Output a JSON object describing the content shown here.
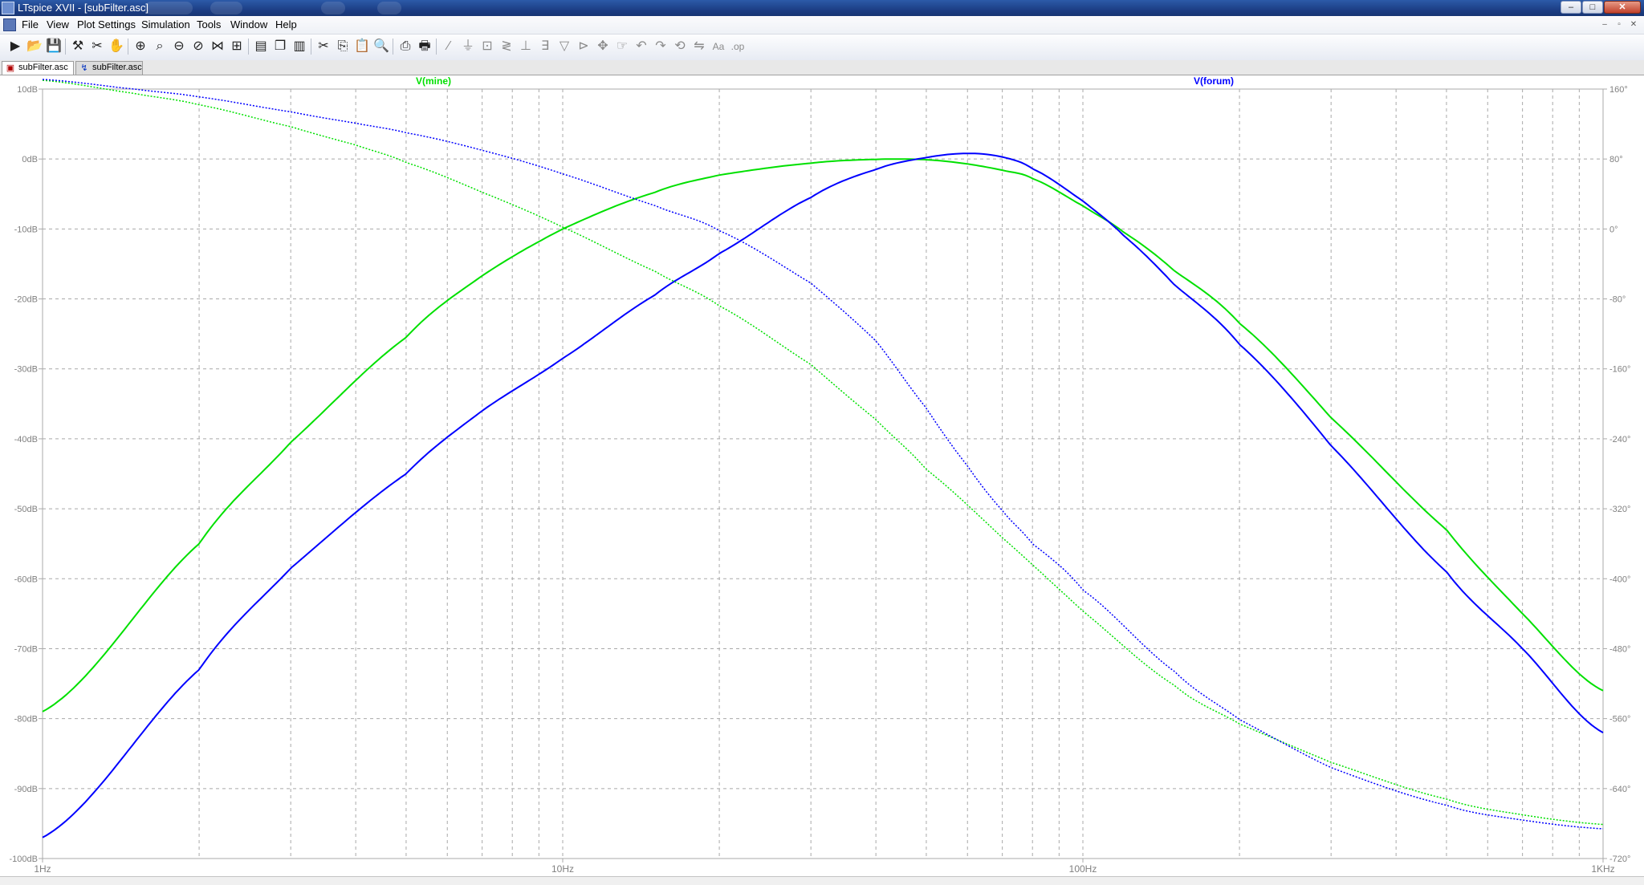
{
  "window": {
    "title": "LTspice XVII - [subFilter.asc]",
    "controls": {
      "minimize": "–",
      "maximize": "□",
      "close": "✕"
    },
    "mdi_controls": {
      "minimize": "–",
      "restore": "▫",
      "close": "✕"
    }
  },
  "menu": {
    "items": [
      {
        "label": "File"
      },
      {
        "label": "View"
      },
      {
        "label": "Plot Settings"
      },
      {
        "label": "Simulation"
      },
      {
        "label": "Tools"
      },
      {
        "label": "Window"
      },
      {
        "label": "Help"
      }
    ]
  },
  "toolbar": {
    "buttons": [
      {
        "name": "run-icon",
        "glyph": "▶"
      },
      {
        "name": "open-icon",
        "glyph": "📂"
      },
      {
        "name": "save-icon",
        "glyph": "💾"
      },
      {
        "name": "probe-icon",
        "glyph": "⚒"
      },
      {
        "name": "halt-icon",
        "glyph": "✂"
      },
      {
        "name": "hand-icon",
        "glyph": "✋"
      },
      {
        "name": "zoom-in-icon",
        "glyph": "⊕"
      },
      {
        "name": "zoom-area-icon",
        "glyph": "⌕"
      },
      {
        "name": "zoom-out-icon",
        "glyph": "⊖"
      },
      {
        "name": "zoom-cancel-icon",
        "glyph": "⊘"
      },
      {
        "name": "autorange-icon",
        "glyph": "⋈"
      },
      {
        "name": "fit-icon",
        "glyph": "⊞"
      },
      {
        "name": "tile-horizontal-icon",
        "glyph": "▤"
      },
      {
        "name": "cascade-icon",
        "glyph": "❐"
      },
      {
        "name": "tile-vertical-icon",
        "glyph": "▥"
      },
      {
        "name": "cut-icon",
        "glyph": "✂"
      },
      {
        "name": "copy-icon",
        "glyph": "⎘"
      },
      {
        "name": "paste-icon",
        "glyph": "📋"
      },
      {
        "name": "find-icon",
        "glyph": "🔍"
      },
      {
        "name": "print-preview-icon",
        "glyph": "⎙"
      },
      {
        "name": "print-icon",
        "glyph": "🖶"
      },
      {
        "name": "wire-icon",
        "glyph": "∕"
      },
      {
        "name": "ground-icon",
        "glyph": "⏚"
      },
      {
        "name": "label-icon",
        "glyph": "⊡"
      },
      {
        "name": "resistor-icon",
        "glyph": "≷"
      },
      {
        "name": "capacitor-icon",
        "glyph": "⊥"
      },
      {
        "name": "inductor-icon",
        "glyph": "∃"
      },
      {
        "name": "diode-icon",
        "glyph": "▽"
      },
      {
        "name": "component-icon",
        "glyph": "⊳"
      },
      {
        "name": "move-icon",
        "glyph": "✥"
      },
      {
        "name": "drag-icon",
        "glyph": "☞"
      },
      {
        "name": "undo-icon",
        "glyph": "↶"
      },
      {
        "name": "redo-icon",
        "glyph": "↷"
      },
      {
        "name": "rotate-icon",
        "glyph": "⟲"
      },
      {
        "name": "mirror-icon",
        "glyph": "⇋"
      },
      {
        "name": "text-icon",
        "glyph": "Aa"
      },
      {
        "name": "spice-directive-icon",
        "glyph": ".op"
      }
    ]
  },
  "tabs": [
    {
      "label": "subFilter.asc",
      "active": true,
      "icon": "schematic-icon",
      "glyph": "▣"
    },
    {
      "label": "subFilter.asc",
      "active": false,
      "icon": "waveform-icon",
      "glyph": "↯"
    }
  ],
  "plot": {
    "background": "#ffffff",
    "grid_color": "#a9a9a9",
    "axis_text_color": "#808080",
    "traces": [
      {
        "name": "V(mine)",
        "color": "#00e000"
      },
      {
        "name": "V(forum)",
        "color": "#0000ff"
      }
    ],
    "x_axis": {
      "scale": "log",
      "range_hz": [
        1,
        1000
      ],
      "ticks": [
        {
          "value": 1,
          "label": "1Hz"
        },
        {
          "value": 10,
          "label": "10Hz"
        },
        {
          "value": 100,
          "label": "100Hz"
        },
        {
          "value": 1000,
          "label": "1KHz"
        }
      ]
    },
    "y_left": {
      "unit": "dB",
      "range": [
        -100,
        10
      ],
      "ticks": [
        {
          "value": 10,
          "label": "10dB"
        },
        {
          "value": 0,
          "label": "0dB"
        },
        {
          "value": -10,
          "label": "-10dB"
        },
        {
          "value": -20,
          "label": "-20dB"
        },
        {
          "value": -30,
          "label": "-30dB"
        },
        {
          "value": -40,
          "label": "-40dB"
        },
        {
          "value": -50,
          "label": "-50dB"
        },
        {
          "value": -60,
          "label": "-60dB"
        },
        {
          "value": -70,
          "label": "-70dB"
        },
        {
          "value": -80,
          "label": "-80dB"
        },
        {
          "value": -90,
          "label": "-90dB"
        },
        {
          "value": -100,
          "label": "-100dB"
        }
      ]
    },
    "y_right": {
      "unit": "°",
      "range": [
        -720,
        160
      ],
      "ticks": [
        {
          "value": 160,
          "label": "160°"
        },
        {
          "value": 80,
          "label": "80°"
        },
        {
          "value": 0,
          "label": "0°"
        },
        {
          "value": -80,
          "label": "-80°"
        },
        {
          "value": -160,
          "label": "-160°"
        },
        {
          "value": -240,
          "label": "-240°"
        },
        {
          "value": -320,
          "label": "-320°"
        },
        {
          "value": -400,
          "label": "-400°"
        },
        {
          "value": -480,
          "label": "-480°"
        },
        {
          "value": -560,
          "label": "-560°"
        },
        {
          "value": -640,
          "label": "-640°"
        },
        {
          "value": -720,
          "label": "-720°"
        }
      ]
    },
    "curves": [
      {
        "trace": "V(mine)",
        "kind": "magnitude",
        "axis": "left",
        "points": [
          [
            1,
            -79
          ],
          [
            2,
            -55
          ],
          [
            3,
            -40.5
          ],
          [
            5,
            -25.5
          ],
          [
            7,
            -16.7
          ],
          [
            10,
            -10
          ],
          [
            15,
            -4.8
          ],
          [
            20,
            -2.3
          ],
          [
            30,
            -0.6
          ],
          [
            40,
            -0.05
          ],
          [
            50,
            -0.1
          ],
          [
            60,
            -0.7
          ],
          [
            70,
            -1.6
          ],
          [
            80,
            -2.8
          ],
          [
            100,
            -6.7
          ],
          [
            120,
            -10.5
          ],
          [
            150,
            -16
          ],
          [
            200,
            -23.5
          ],
          [
            300,
            -37
          ],
          [
            500,
            -53
          ],
          [
            700,
            -65
          ],
          [
            1000,
            -76
          ]
        ]
      },
      {
        "trace": "V(forum)",
        "kind": "magnitude",
        "axis": "left",
        "points": [
          [
            1,
            -97
          ],
          [
            2,
            -73
          ],
          [
            3,
            -58.5
          ],
          [
            5,
            -45
          ],
          [
            7,
            -36
          ],
          [
            10,
            -28.5
          ],
          [
            15,
            -19.5
          ],
          [
            20,
            -13.5
          ],
          [
            30,
            -5.5
          ],
          [
            40,
            -1.5
          ],
          [
            50,
            0.2
          ],
          [
            60,
            0.8
          ],
          [
            70,
            0.3
          ],
          [
            80,
            -1.4
          ],
          [
            100,
            -6
          ],
          [
            120,
            -11
          ],
          [
            150,
            -18
          ],
          [
            200,
            -26.5
          ],
          [
            300,
            -41
          ],
          [
            500,
            -59
          ],
          [
            700,
            -70
          ],
          [
            1000,
            -82
          ]
        ]
      },
      {
        "trace": "V(mine)",
        "kind": "phase",
        "axis": "right",
        "points": [
          [
            1,
            170
          ],
          [
            1.5,
            155
          ],
          [
            2,
            142
          ],
          [
            3,
            117
          ],
          [
            4,
            96
          ],
          [
            5,
            76
          ],
          [
            7,
            42
          ],
          [
            10,
            2
          ],
          [
            15,
            -48
          ],
          [
            20,
            -88
          ],
          [
            30,
            -155
          ],
          [
            40,
            -218
          ],
          [
            50,
            -275
          ],
          [
            70,
            -353
          ],
          [
            100,
            -437
          ],
          [
            150,
            -522
          ],
          [
            200,
            -566
          ],
          [
            300,
            -610
          ],
          [
            500,
            -652
          ],
          [
            700,
            -670
          ],
          [
            1000,
            -681
          ]
        ]
      },
      {
        "trace": "V(forum)",
        "kind": "phase",
        "axis": "right",
        "points": [
          [
            1,
            171
          ],
          [
            1.5,
            160
          ],
          [
            2,
            151
          ],
          [
            3,
            134
          ],
          [
            4,
            121
          ],
          [
            5,
            110
          ],
          [
            7,
            90
          ],
          [
            10,
            63
          ],
          [
            15,
            27
          ],
          [
            20,
            -2
          ],
          [
            30,
            -62
          ],
          [
            40,
            -128
          ],
          [
            50,
            -205
          ],
          [
            60,
            -271
          ],
          [
            70,
            -322
          ],
          [
            80,
            -360
          ],
          [
            100,
            -413
          ],
          [
            150,
            -506
          ],
          [
            200,
            -561
          ],
          [
            300,
            -616
          ],
          [
            500,
            -659
          ],
          [
            700,
            -676
          ],
          [
            1000,
            -686
          ]
        ]
      }
    ]
  }
}
